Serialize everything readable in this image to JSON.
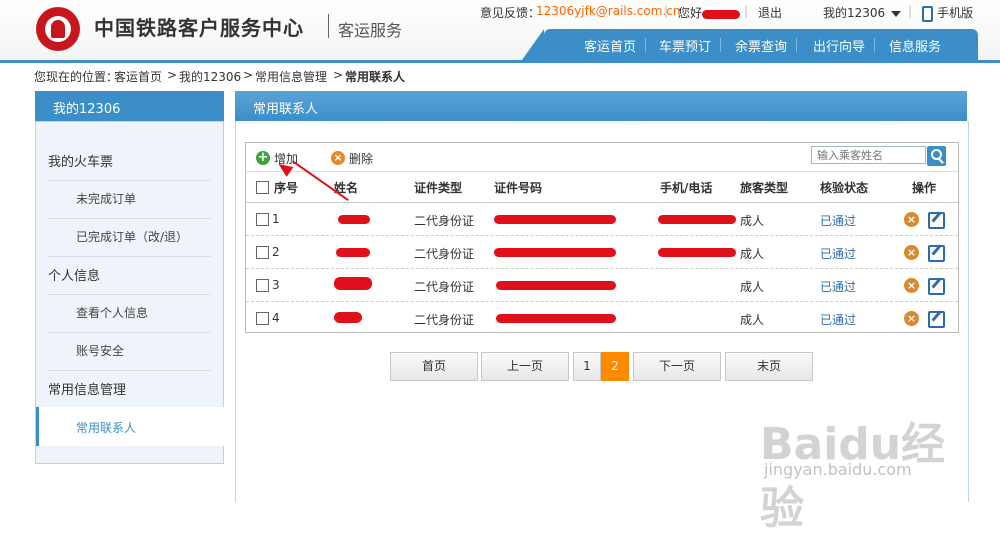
{
  "header": {
    "site_title": "中国铁路客户服务中心",
    "site_subtitle": "客运服务",
    "feedback_label": "意见反馈：",
    "feedback_email": "12306yjfk@rails.com.cn",
    "greeting": "您好，",
    "logout": "退出",
    "my12306": "我的12306",
    "mobile": "手机版",
    "nav": [
      "客运首页",
      "车票预订",
      "余票查询",
      "出行向导",
      "信息服务"
    ]
  },
  "breadcrumb": {
    "prefix": "您现在的位置：",
    "items": [
      "客运首页",
      "我的12306",
      "常用信息管理"
    ],
    "current": "常用联系人",
    "sep": ">"
  },
  "sidebar": {
    "title": "我的12306",
    "sections": [
      {
        "label": "我的火车票",
        "items": [
          "未完成订单",
          "已完成订单（改/退）"
        ]
      },
      {
        "label": "个人信息",
        "items": [
          "查看个人信息",
          "账号安全"
        ]
      },
      {
        "label": "常用信息管理",
        "items": [
          "常用联系人"
        ]
      }
    ],
    "active": "常用联系人"
  },
  "main": {
    "title": "常用联系人",
    "toolbar": {
      "add_label": "增加",
      "delete_label": "删除",
      "search_placeholder": "输入乘客姓名"
    },
    "columns": [
      "序号",
      "姓名",
      "证件类型",
      "证件号码",
      "手机/电话",
      "旅客类型",
      "核验状态",
      "操作"
    ],
    "rows": [
      {
        "no": "1",
        "id_type": "二代身份证",
        "passenger_type": "成人",
        "status": "已通过"
      },
      {
        "no": "2",
        "id_type": "二代身份证",
        "passenger_type": "成人",
        "status": "已通过"
      },
      {
        "no": "3",
        "id_type": "二代身份证",
        "passenger_type": "成人",
        "status": "已通过"
      },
      {
        "no": "4",
        "id_type": "二代身份证",
        "passenger_type": "成人",
        "status": "已通过"
      }
    ]
  },
  "pagination": {
    "first": "首页",
    "prev": "上一页",
    "pages": [
      "1",
      "2"
    ],
    "current_page": "2",
    "next": "下一页",
    "last": "末页"
  },
  "watermark": {
    "brand": "Baidu经验",
    "url": "jingyan.baidu.com"
  },
  "colors": {
    "primary": "#3c8ec9",
    "accent": "#ff6600",
    "redaction": "#e0101a",
    "page_active": "#ff8a00"
  }
}
